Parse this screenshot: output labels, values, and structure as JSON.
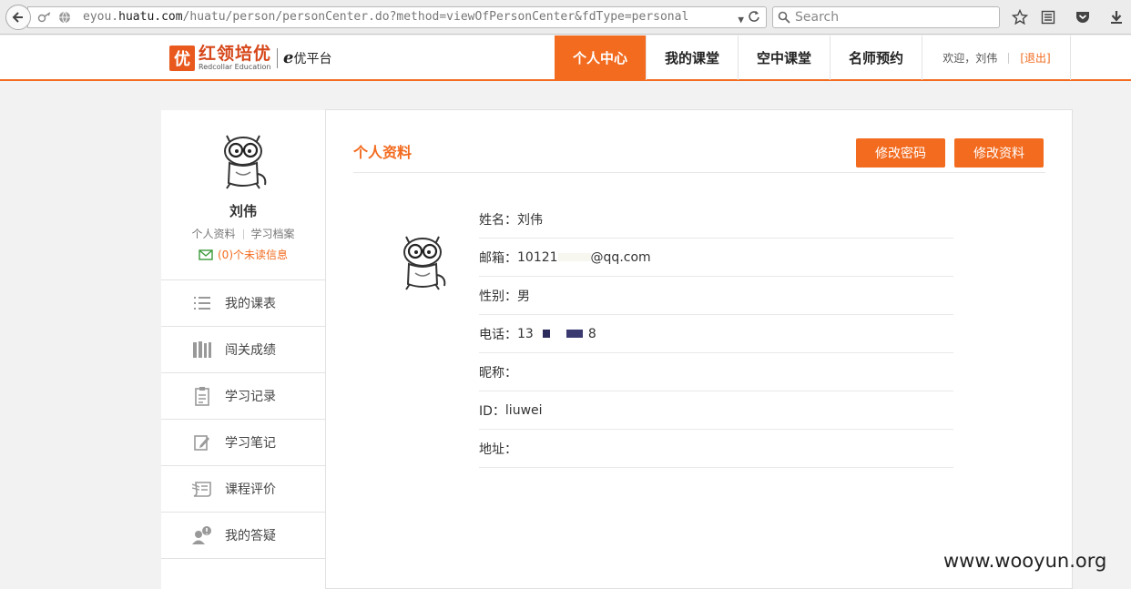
{
  "browser": {
    "url_prefix": "eyou.",
    "url_host": "huatu.com",
    "url_path": "/huatu/person/personCenter.do?method=viewOfPersonCenter&fdType=personal",
    "search_placeholder": "Search"
  },
  "header": {
    "logo_mark": "优",
    "logo_cn": "红领培优",
    "logo_en": "Redcollar Education",
    "platform_e": "e",
    "platform_text": "优平台",
    "nav": [
      "个人中心",
      "我的课堂",
      "空中课堂",
      "名师预约"
    ],
    "welcome": "欢迎，刘伟",
    "logout": "[退出]"
  },
  "sidebar": {
    "name": "刘伟",
    "link_profile": "个人资料",
    "link_archive": "学习档案",
    "messages": "(0)个未读信息",
    "menu": [
      "我的课表",
      "闯关成绩",
      "学习记录",
      "学习笔记",
      "课程评价",
      "我的答疑"
    ]
  },
  "main": {
    "title": "个人资料",
    "btn_password": "修改密码",
    "btn_edit": "修改资料",
    "fields": [
      {
        "label": "姓名：",
        "value": "刘伟"
      },
      {
        "label": "邮箱：",
        "value": "10121",
        "value_tail": "@qq.com"
      },
      {
        "label": "性别：",
        "value": "男"
      },
      {
        "label": "电话：",
        "value": "13",
        "value_tail": "8"
      },
      {
        "label": "昵称：",
        "value": ""
      },
      {
        "label": "ID：",
        "value": "liuwei"
      },
      {
        "label": "地址：",
        "value": ""
      }
    ]
  },
  "watermark": "www.wooyun.org",
  "colors": {
    "accent": "#f26b1f"
  }
}
